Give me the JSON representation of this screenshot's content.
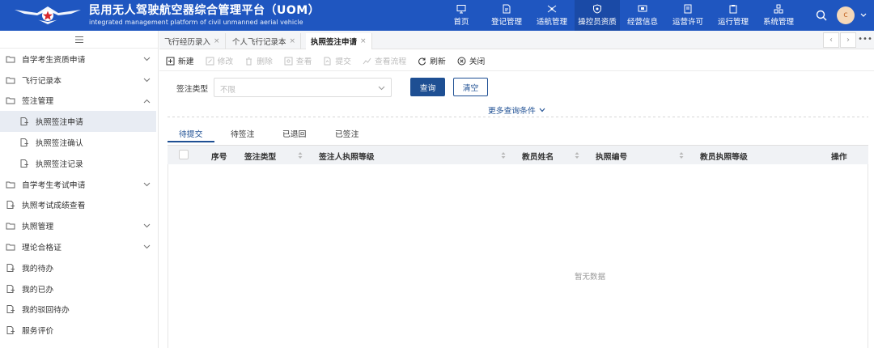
{
  "header": {
    "title_cn": "民用无人驾驶航空器综合管理平台（UOM）",
    "title_en": "integrated management platform of civil unmanned aerial vehicle",
    "nav": [
      {
        "label": "首页",
        "icon": "monitor-icon"
      },
      {
        "label": "登记管理",
        "icon": "document-edit-icon"
      },
      {
        "label": "适航管理",
        "icon": "drone-icon"
      },
      {
        "label": "操控员资质",
        "icon": "shield-icon",
        "active": true
      },
      {
        "label": "经营信息",
        "icon": "screen-icon"
      },
      {
        "label": "运营许可",
        "icon": "certificate-icon"
      },
      {
        "label": "运行管理",
        "icon": "clipboard-icon"
      },
      {
        "label": "系统管理",
        "icon": "cubes-icon"
      }
    ],
    "avatar_text": "c",
    "bg_color": "#1f56c0"
  },
  "sidebar": {
    "items": [
      {
        "label": "自学考生资质申请",
        "icon": "folder-icon",
        "arrow": "down"
      },
      {
        "label": "飞行记录本",
        "icon": "folder-icon",
        "arrow": "down"
      },
      {
        "label": "签注管理",
        "icon": "folder-icon",
        "arrow": "up"
      },
      {
        "label": "执照签注申请",
        "icon": "file-stack-icon",
        "sub": true,
        "active": true
      },
      {
        "label": "执照签注确认",
        "icon": "file-stack-icon",
        "sub": true
      },
      {
        "label": "执照签注记录",
        "icon": "file-stack-icon",
        "sub": true
      },
      {
        "label": "自学考生考试申请",
        "icon": "folder-icon",
        "arrow": "down"
      },
      {
        "label": "执照考试成绩查看",
        "icon": "file-stack-icon"
      },
      {
        "label": "执照管理",
        "icon": "folder-icon",
        "arrow": "down"
      },
      {
        "label": "理论合格证",
        "icon": "folder-icon",
        "arrow": "down"
      },
      {
        "label": "我的待办",
        "icon": "file-stack-icon"
      },
      {
        "label": "我的已办",
        "icon": "file-stack-icon"
      },
      {
        "label": "我的驳回待办",
        "icon": "file-stack-icon"
      },
      {
        "label": "服务评价",
        "icon": "file-stack-icon"
      }
    ]
  },
  "tabs": [
    {
      "label": "飞行经历录入",
      "close": "×"
    },
    {
      "label": "个人飞行记录本",
      "close": "×"
    },
    {
      "label": "执照签注申请",
      "close": "×",
      "active": true
    }
  ],
  "toolbar": [
    {
      "label": "新建",
      "icon": "plus-square-icon",
      "enabled": true
    },
    {
      "label": "修改",
      "icon": "edit-icon",
      "enabled": false
    },
    {
      "label": "删除",
      "icon": "trash-icon",
      "enabled": false
    },
    {
      "label": "查看",
      "icon": "view-icon",
      "enabled": false
    },
    {
      "label": "提交",
      "icon": "submit-icon",
      "enabled": false
    },
    {
      "label": "查看流程",
      "icon": "flow-icon",
      "enabled": false
    },
    {
      "label": "刷新",
      "icon": "refresh-icon",
      "enabled": true
    },
    {
      "label": "关闭",
      "icon": "close-circle-icon",
      "enabled": true
    }
  ],
  "filter": {
    "label": "签注类型",
    "placeholder": "不限",
    "query_label": "查询",
    "clear_label": "清空",
    "more_label": "更多查询条件"
  },
  "status_tabs": [
    "待提交",
    "待签注",
    "已退回",
    "已签注"
  ],
  "table": {
    "columns": [
      "序号",
      "签注类型",
      "签注人执照等级",
      "教员姓名",
      "执照编号",
      "教员执照等级",
      "操作"
    ],
    "empty_text": "暂无数据"
  },
  "accent_color": "#1e4f93"
}
